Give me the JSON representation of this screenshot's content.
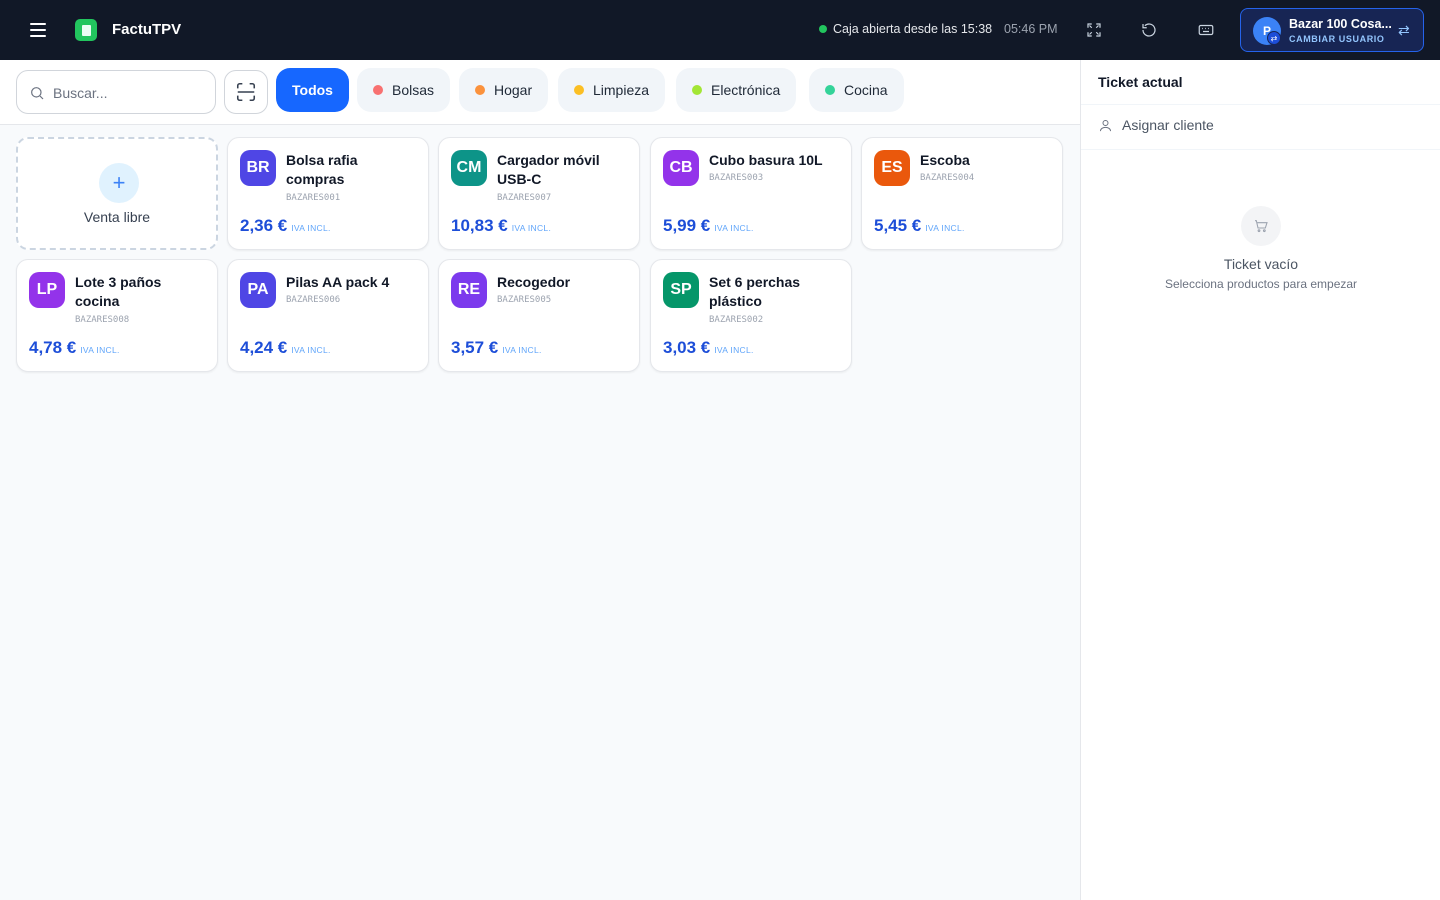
{
  "header": {
    "app_title": "FactuTPV",
    "status_text": "Caja abierta desde las 15:38",
    "time": "05:46 PM",
    "icons": [
      "menu-icon",
      "expand-icon",
      "refresh-icon",
      "keyboard-icon",
      "swap-icon"
    ],
    "user": {
      "initial": "P",
      "name": "Bazar 100 Cosa...",
      "action": "CAMBIAR USUARIO"
    }
  },
  "filters": {
    "search_placeholder": "Buscar...",
    "categories": [
      {
        "label": "Todos",
        "color": null,
        "active": true
      },
      {
        "label": "Bolsas",
        "color": "#f87171"
      },
      {
        "label": "Hogar",
        "color": "#fb923c"
      },
      {
        "label": "Limpieza",
        "color": "#fbbf24"
      },
      {
        "label": "Electrónica",
        "color": "#a3e635"
      },
      {
        "label": "Cocina",
        "color": "#34d399"
      }
    ]
  },
  "free_sale": {
    "label": "Venta libre"
  },
  "products": [
    {
      "initials": "BR",
      "name": "Bolsa rafia compras",
      "sku": "BAZARES001",
      "price": "2,36 €",
      "tax": "IVA INCL.",
      "color": "#4f46e5"
    },
    {
      "initials": "CM",
      "name": "Cargador móvil USB-C",
      "sku": "BAZARES007",
      "price": "10,83 €",
      "tax": "IVA INCL.",
      "color": "#0d9488"
    },
    {
      "initials": "CB",
      "name": "Cubo basura 10L",
      "sku": "BAZARES003",
      "price": "5,99 €",
      "tax": "IVA INCL.",
      "color": "#9333ea"
    },
    {
      "initials": "ES",
      "name": "Escoba",
      "sku": "BAZARES004",
      "price": "5,45 €",
      "tax": "IVA INCL.",
      "color": "#ea580c"
    },
    {
      "initials": "LP",
      "name": "Lote 3 paños cocina",
      "sku": "BAZARES008",
      "price": "4,78 €",
      "tax": "IVA INCL.",
      "color": "#9333ea"
    },
    {
      "initials": "PA",
      "name": "Pilas AA pack 4",
      "sku": "BAZARES006",
      "price": "4,24 €",
      "tax": "IVA INCL.",
      "color": "#4f46e5"
    },
    {
      "initials": "RE",
      "name": "Recogedor",
      "sku": "BAZARES005",
      "price": "3,57 €",
      "tax": "IVA INCL.",
      "color": "#7c3aed"
    },
    {
      "initials": "SP",
      "name": "Set 6 perchas plástico",
      "sku": "BAZARES002",
      "price": "3,03 €",
      "tax": "IVA INCL.",
      "color": "#059669"
    }
  ],
  "ticket": {
    "title": "Ticket actual",
    "assign_client": "Asignar cliente",
    "empty_title": "Ticket vacío",
    "empty_subtitle": "Selecciona productos para empezar"
  }
}
